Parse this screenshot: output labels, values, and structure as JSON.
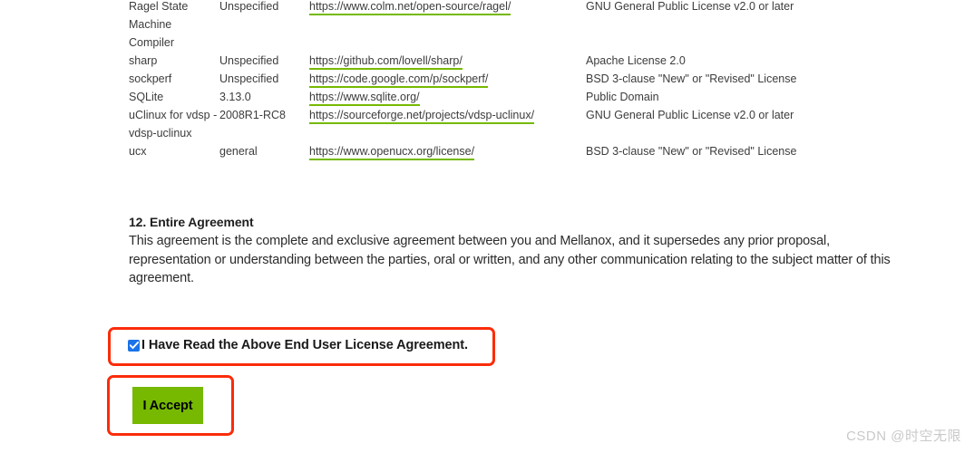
{
  "page": {
    "background_color": "#ffffff",
    "link_underline_color": "#76b900",
    "highlight_color": "#fb2c0a",
    "accent_green": "#76b900",
    "checkbox_color": "#1a73e8"
  },
  "license_table": {
    "rows": [
      {
        "name": "Ragel State Machine Compiler",
        "version": "Unspecified",
        "url": "https://www.colm.net/open-source/ragel/",
        "license": "GNU General Public License v2.0 or later",
        "name_lines": [
          "Ragel State",
          "Machine",
          "Compiler"
        ]
      },
      {
        "name": "sharp",
        "version": "Unspecified",
        "url": "https://github.com/lovell/sharp/",
        "license": "Apache License 2.0",
        "name_lines": [
          "sharp"
        ]
      },
      {
        "name": "sockperf",
        "version": "Unspecified",
        "url": "https://code.google.com/p/sockperf/",
        "license": "BSD 3-clause \"New\" or \"Revised\" License",
        "name_lines": [
          "sockperf"
        ]
      },
      {
        "name": "SQLite",
        "version": "3.13.0",
        "url": "https://www.sqlite.org/",
        "license": "Public Domain",
        "name_lines": [
          "SQLite"
        ]
      },
      {
        "name": "uClinux for vdsp - vdsp-uclinux",
        "version": "2008R1-RC8",
        "url": "https://sourceforge.net/projects/vdsp-uclinux/",
        "license": "GNU General Public License v2.0 or later",
        "name_lines": [
          "uClinux for vdsp -",
          "vdsp-uclinux"
        ]
      },
      {
        "name": "ucx",
        "version": "general",
        "url": "https://www.openucx.org/license/",
        "license": "BSD 3-clause \"New\" or \"Revised\" License",
        "name_lines": [
          "ucx"
        ]
      }
    ],
    "cells": [
      {
        "name": "Ragel State",
        "version": "Unspecified",
        "url": "https://www.colm.net/open-source/ragel/",
        "license": "GNU General Public License v2.0 or later"
      },
      {
        "name": "Machine",
        "version": "",
        "url": "",
        "license": ""
      },
      {
        "name": "Compiler",
        "version": "",
        "url": "",
        "license": ""
      },
      {
        "name": "sharp",
        "version": "Unspecified",
        "url": "https://github.com/lovell/sharp/",
        "license": "Apache License 2.0"
      },
      {
        "name": "sockperf",
        "version": "Unspecified",
        "url": "https://code.google.com/p/sockperf/",
        "license": "BSD 3-clause \"New\" or \"Revised\" License"
      },
      {
        "name": "SQLite",
        "version": "3.13.0",
        "url": "https://www.sqlite.org/",
        "license": "Public Domain"
      },
      {
        "name": "uClinux for vdsp -",
        "version": "2008R1-RC8",
        "url": "https://sourceforge.net/projects/vdsp-uclinux/",
        "license": "GNU General Public License v2.0 or later"
      },
      {
        "name": "vdsp-uclinux",
        "version": "",
        "url": "",
        "license": ""
      },
      {
        "name": "ucx",
        "version": "general",
        "url": "https://www.openucx.org/license/",
        "license": "BSD 3-clause \"New\" or \"Revised\" License"
      }
    ]
  },
  "entire_agreement": {
    "heading": "12. Entire Agreement",
    "body": "This agreement is the complete and exclusive agreement between you and Mellanox, and it supersedes any prior proposal, representation or understanding between the parties, oral or written, and any other communication relating to the subject matter of this agreement."
  },
  "eula": {
    "checkbox_label": "I Have Read the Above End User License Agreement.",
    "checkbox_checked": true,
    "accept_button_label": "I Accept"
  },
  "watermark": {
    "text": "CSDN @时空无限"
  }
}
